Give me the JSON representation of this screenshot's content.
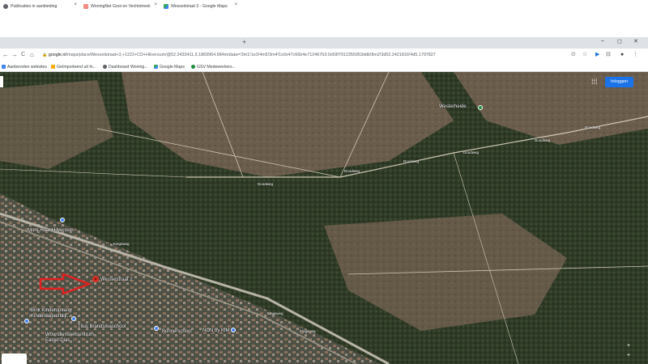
{
  "tabs": [
    {
      "label": "Publicaties in aanbieding",
      "active": false,
      "icon": "globe-icon"
    },
    {
      "label": "WoningNet Gooi en Vechtstreek",
      "active": false,
      "icon": "woningnet-icon"
    },
    {
      "label": "Wesselstraat 3 - Google Maps",
      "active": true,
      "icon": "maps-icon"
    }
  ],
  "new_tab": "+",
  "window_controls": {
    "minimize": "–",
    "maximize": "◻",
    "close": "✕"
  },
  "nav": {
    "back": "←",
    "forward": "→",
    "reload": "C",
    "home": "⌂",
    "lock": "🔒"
  },
  "url": {
    "domain": "google.nl",
    "path": "/maps/place/Wesselstraat+3,+1222+CD+Hilversum/@52.2433411,5.1869964,684m/data=!3m1!1e3!4m5!3m4!1s0x47c66b4e71246763:0x59f7912355953ddb!8m2!3d52.2421816!4d5.1797827"
  },
  "toolbar_right": {
    "location": "⊙",
    "star": "☆",
    "cast": "▶",
    "extensions": "⊟",
    "profile": "●",
    "menu": "⋮"
  },
  "bookmarks": [
    {
      "label": "Aanbevolen websites",
      "icon": "apps-icon"
    },
    {
      "label": "Geïmporteerd uit In...",
      "icon": "folder-icon"
    },
    {
      "label": "Dashboard Woning...",
      "icon": "globe-icon"
    },
    {
      "label": "Google Maps",
      "icon": "maps-icon"
    },
    {
      "label": "GSV Medewerkers...",
      "icon": "gsv-icon"
    }
  ],
  "map": {
    "apps_icon": "⋮⋮⋮",
    "signin": "Inloggen",
    "labels": {
      "westerheide": "Westerheide",
      "more_hilversum": "More Haar Hilversum",
      "wesselstraat": "Wesselstraat 2",
      "kinderopvang": "Bink Kinderopvang Kinderdagverblijf...",
      "brandsma": "Titus Brandsmaschool",
      "woondienst": "Woondienstencentrum Eastel Dias...",
      "bonnerschool": "Bonnerschool",
      "nonbykim": "NON by KIM"
    },
    "roads": {
      "doodweg1": "Doodweg",
      "doodweg2": "Doodweg",
      "doodweg3": "Doodweg",
      "doodweg4": "Doodweg",
      "doodweg5": "Doodweg",
      "doodweg6": "Doodweg",
      "kingsweg1": "Kingsweg",
      "kingsweg2": "Kingsweg",
      "kingsweg3": "Kingsweg"
    },
    "zoom_in": "+",
    "zoom_out": "+"
  },
  "colors": {
    "accent": "#1a73e8",
    "arrow": "#e02020",
    "pin": "#d93025"
  }
}
